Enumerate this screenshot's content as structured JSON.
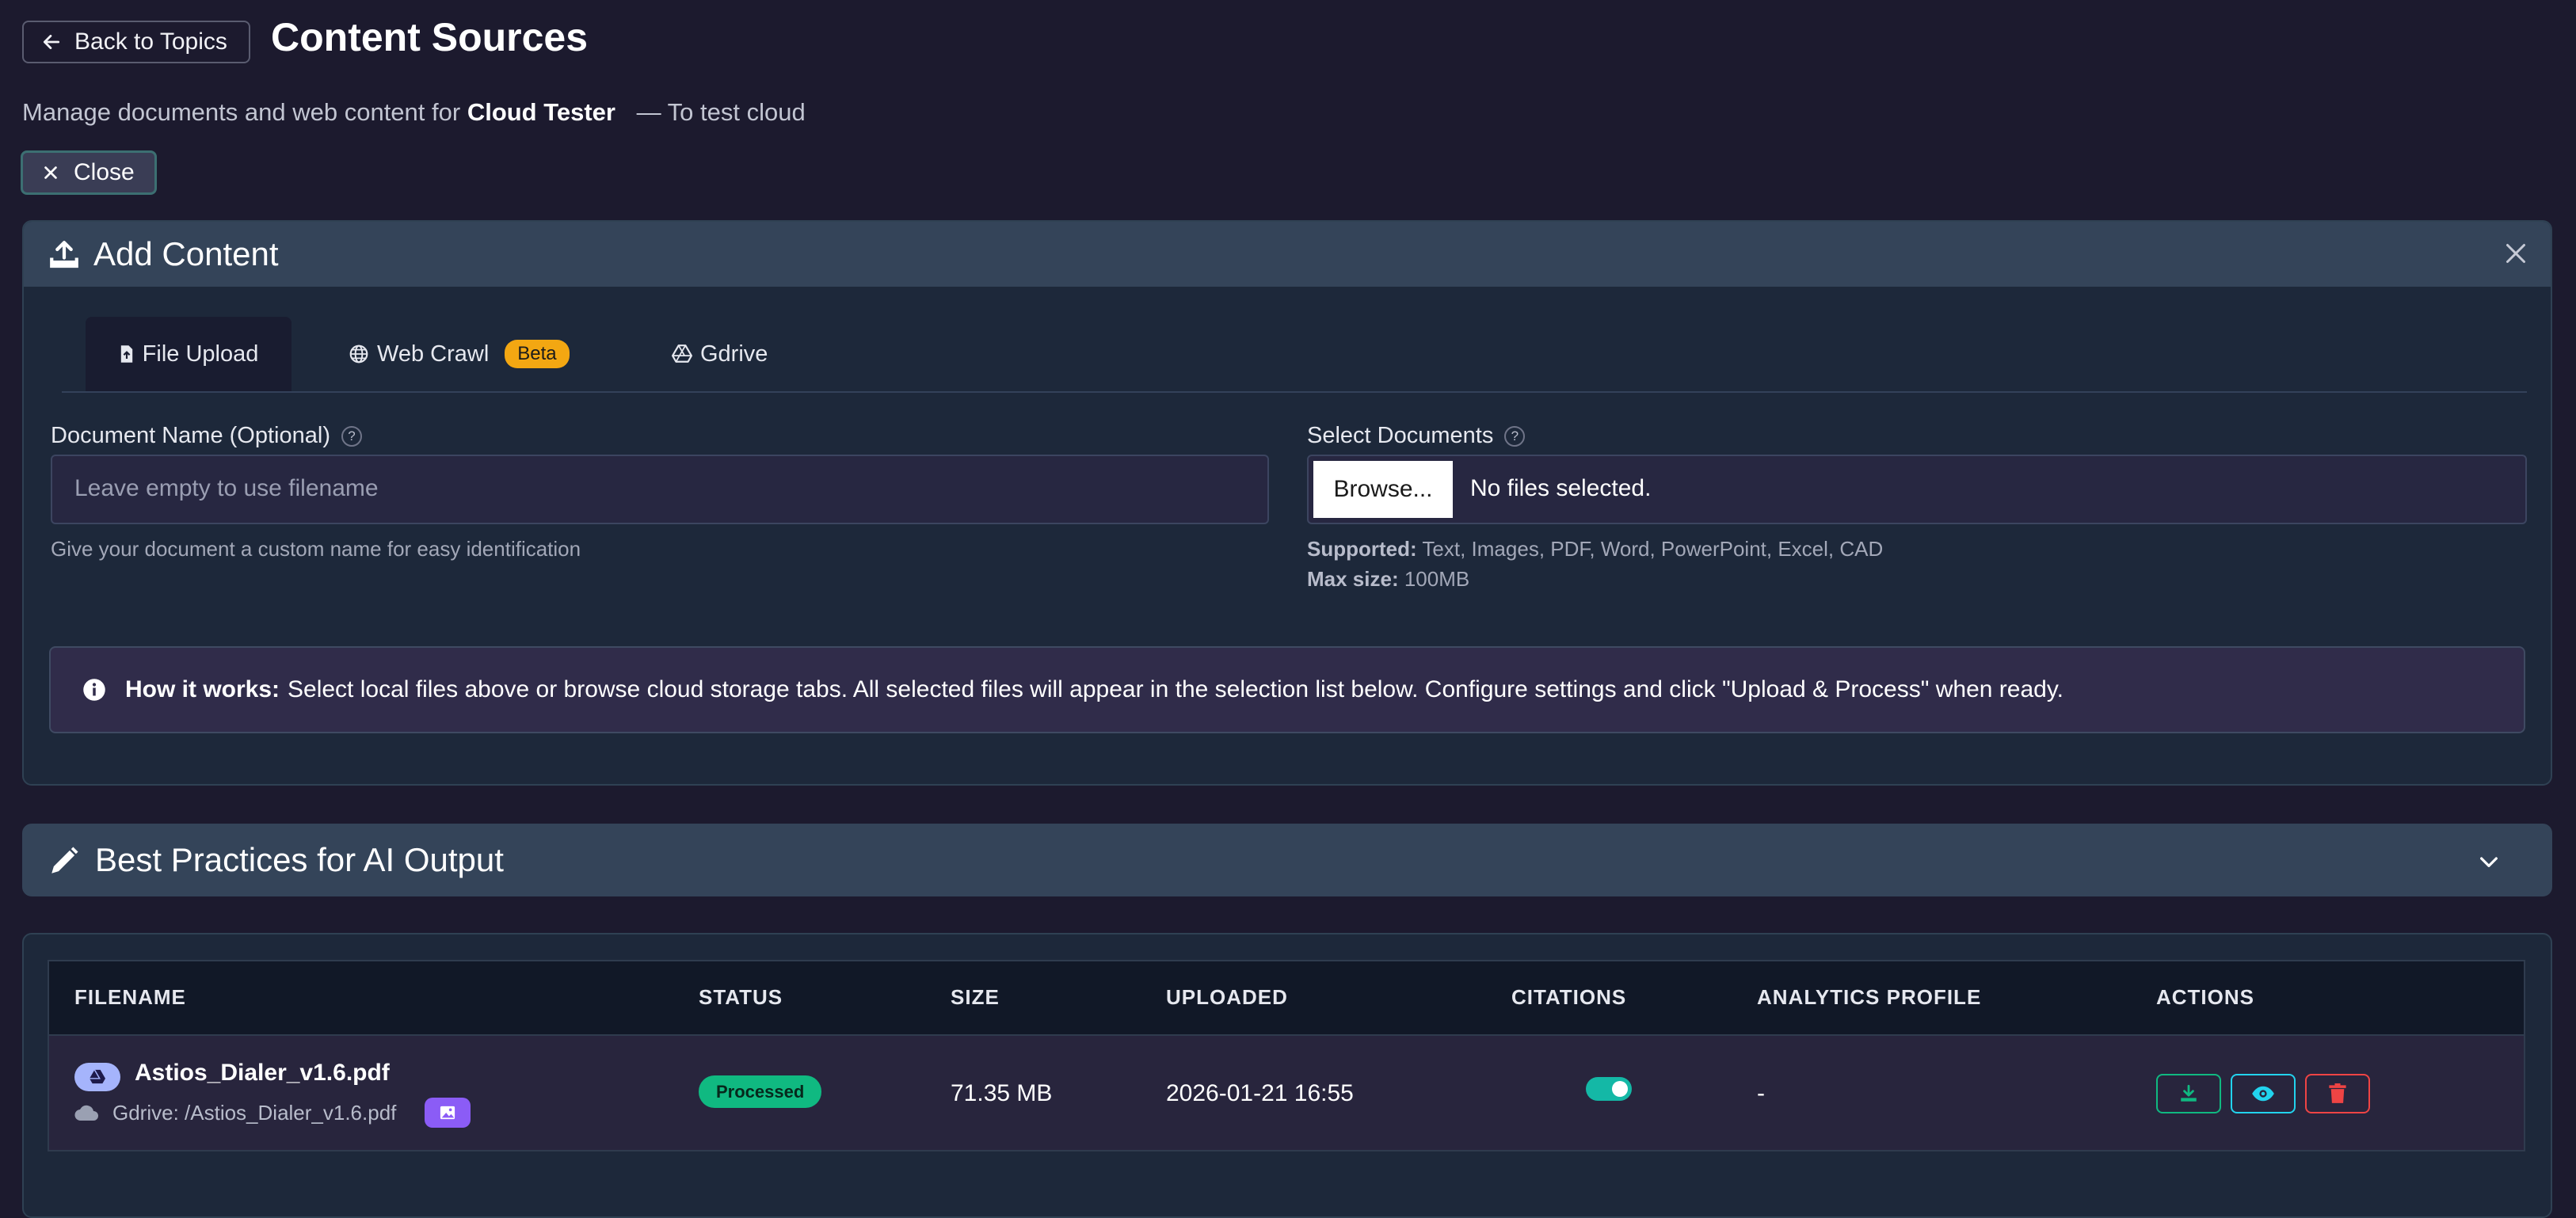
{
  "header": {
    "back_label": "Back to Topics",
    "title": "Content Sources",
    "subtitle_prefix": "Manage documents and web content for",
    "topic_name": "Cloud Tester",
    "topic_desc": "— To test cloud",
    "close_label": "Close"
  },
  "add_content": {
    "title": "Add Content",
    "tabs": [
      {
        "label": "File Upload",
        "icon": "file-icon",
        "active": true
      },
      {
        "label": "Web Crawl",
        "icon": "globe-icon",
        "badge": "Beta"
      },
      {
        "label": "Gdrive",
        "icon": "gdrive-icon"
      }
    ],
    "doc_name": {
      "label": "Document Name (Optional)",
      "placeholder": "Leave empty to use filename",
      "hint": "Give your document a custom name for easy identification"
    },
    "select_docs": {
      "label": "Select Documents",
      "browse_label": "Browse...",
      "status": "No files selected.",
      "supported_label": "Supported:",
      "supported_value": "Text, Images, PDF, Word, PowerPoint, Excel, CAD",
      "maxsize_label": "Max size:",
      "maxsize_value": "100MB"
    },
    "how_it_works": {
      "label": "How it works:",
      "text": "Select local files above or browse cloud storage tabs. All selected files will appear in the selection list below. Configure settings and click \"Upload & Process\" when ready."
    }
  },
  "best_practices": {
    "title": "Best Practices for AI Output"
  },
  "table": {
    "columns": [
      "FILENAME",
      "STATUS",
      "SIZE",
      "UPLOADED",
      "CITATIONS",
      "ANALYTICS PROFILE",
      "ACTIONS"
    ],
    "rows": [
      {
        "filename": "Astios_Dialer_v1.6.pdf",
        "source": "Gdrive: /Astios_Dialer_v1.6.pdf",
        "status": "Processed",
        "size": "71.35 MB",
        "uploaded": "2026-01-21 16:55",
        "citations_on": true,
        "analytics_profile": "-"
      }
    ]
  },
  "colors": {
    "background": "#1c1a2e",
    "card": "#1d283a",
    "card_header": "#344459",
    "beta": "#f3a712",
    "processed": "#10b981",
    "toggle": "#14b8a6",
    "danger": "#ef4444"
  }
}
